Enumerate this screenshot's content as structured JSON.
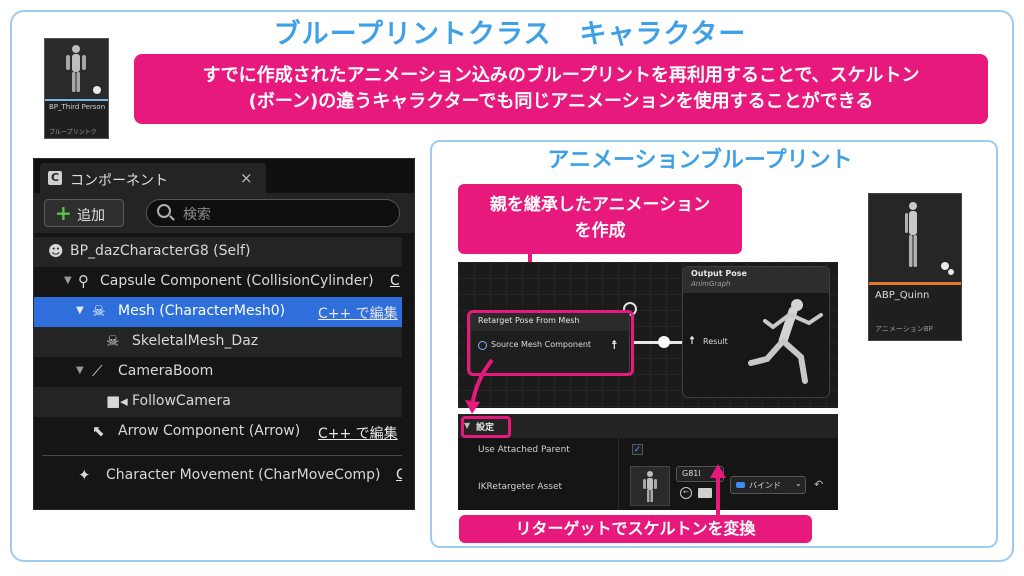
{
  "colors": {
    "accent_pink": "#e8197d",
    "title_blue": "#3fa0e8",
    "frame_blue": "#9fcbee",
    "selection_blue": "#2f6fdb"
  },
  "header": {
    "title": "ブループリントクラス　キャラクター"
  },
  "asset_character": {
    "name": "BP_Third Person",
    "type": "ブループリントク",
    "icon": "mannequin-icon"
  },
  "callouts": {
    "main_line1": "すでに作成されたアニメーション込みのブループリントを再利用することで、スケルトン",
    "main_line2": "(ボーン)の違うキャラクターでも同じアニメーションを使用することができる",
    "parent_line1": "親を継承したアニメーション",
    "parent_line2": "を作成",
    "retarget": "リターゲットでスケルトンを変換"
  },
  "components_panel": {
    "tab_label": "コンポーネント",
    "close": "×",
    "add_label": "追加",
    "search_placeholder": "検索",
    "cpp_edit": "C++ で編集",
    "rows": [
      {
        "label": "BP_dazCharacterG8 (Self)",
        "icon": "person-icon"
      },
      {
        "label": "Capsule Component (CollisionCylinder)",
        "icon": "capsule-icon",
        "suffix": "C"
      },
      {
        "label": "Mesh (CharacterMesh0)",
        "icon": "skeleton-icon"
      },
      {
        "label": "SkeletalMesh_Daz",
        "icon": "skeleton-icon"
      },
      {
        "label": "CameraBoom",
        "icon": "spring-arm-icon"
      },
      {
        "label": "FollowCamera",
        "icon": "camera-icon"
      },
      {
        "label": "Arrow Component (Arrow)",
        "icon": "arrow-icon"
      },
      {
        "label": "Character Movement (CharMoveComp)",
        "icon": "movement-icon",
        "suffix": "C"
      }
    ]
  },
  "anim_blueprint": {
    "title": "アニメーションブループリント",
    "retarget_node": {
      "title": "Retarget Pose From Mesh",
      "pin": "Source Mesh Component"
    },
    "output_node": {
      "title": "Output Pose",
      "subtitle": "AnimGraph",
      "pin": "Result"
    },
    "details": {
      "section": "設定",
      "use_attached_parent_label": "Use Attached Parent",
      "use_attached_parent_checked": true,
      "ik_label": "IKRetargeter Asset",
      "ik_value": "G81l",
      "bind_label": "バインド"
    }
  },
  "asset_abp": {
    "name": "ABP_Quinn",
    "type": "アニメーションBP",
    "icon": "mannequin-icon"
  }
}
